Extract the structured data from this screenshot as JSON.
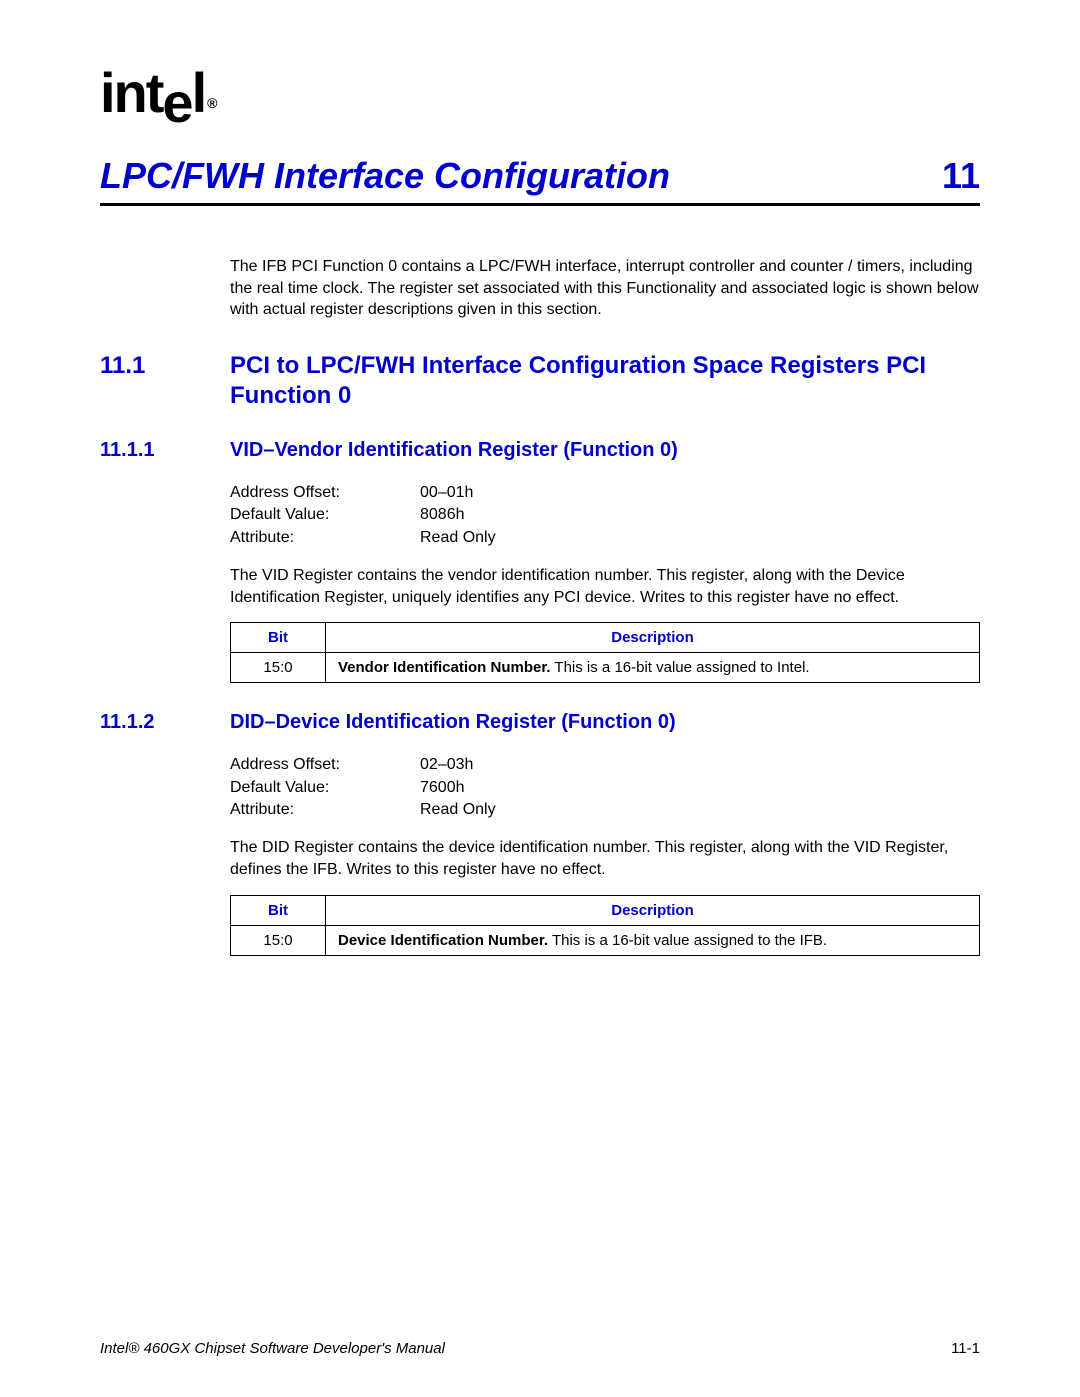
{
  "logo": {
    "text": "intel",
    "registered": "®"
  },
  "chapter": {
    "title": "LPC/FWH Interface Configuration",
    "number": "11"
  },
  "intro": "The IFB PCI Function 0 contains a LPC/FWH interface, interrupt controller and counter / timers, including the real time clock. The register set associated with this Functionality and associated logic is shown below with actual register descriptions given in this section.",
  "section": {
    "number": "11.1",
    "title": "PCI to LPC/FWH Interface Configuration Space Registers PCI Function 0"
  },
  "sub1": {
    "number": "11.1.1",
    "title": "VID–Vendor Identification Register (Function 0)",
    "attrs": {
      "address_offset_label": "Address Offset:",
      "address_offset_value": "00–01h",
      "default_value_label": "Default Value:",
      "default_value_value": "8086h",
      "attribute_label": "Attribute:",
      "attribute_value": "Read Only"
    },
    "desc": "The VID Register contains the vendor identification number. This register, along with the Device Identification Register, uniquely identifies any PCI device. Writes to this register have no effect.",
    "table": {
      "header_bit": "Bit",
      "header_desc": "Description",
      "row_bit": "15:0",
      "row_desc_bold": "Vendor Identification Number.",
      "row_desc_rest": " This is a 16-bit value assigned to Intel."
    }
  },
  "sub2": {
    "number": "11.1.2",
    "title": "DID–Device Identification Register (Function 0)",
    "attrs": {
      "address_offset_label": "Address Offset:",
      "address_offset_value": "02–03h",
      "default_value_label": "Default Value:",
      "default_value_value": "7600h",
      "attribute_label": "Attribute:",
      "attribute_value": "Read Only"
    },
    "desc": "The DID Register contains the device identification number. This register, along with the VID Register, defines the IFB. Writes to this register have no effect.",
    "table": {
      "header_bit": "Bit",
      "header_desc": "Description",
      "row_bit": "15:0",
      "row_desc_bold": "Device Identification Number.",
      "row_desc_rest": " This is a 16-bit value assigned to the IFB."
    }
  },
  "footer": {
    "left": "Intel® 460GX Chipset Software Developer's Manual",
    "right": "11-1"
  }
}
